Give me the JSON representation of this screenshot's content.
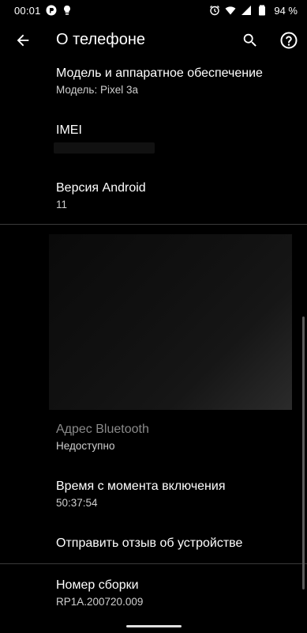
{
  "status_bar": {
    "time": "00:01",
    "battery": "94 %",
    "left_icons": [
      "app-notification-icon",
      "lightbulb-icon"
    ],
    "right_icons": [
      "alarm-icon",
      "wifi-icon",
      "signal-icon",
      "battery-icon"
    ]
  },
  "app_bar": {
    "title": "О телефоне",
    "icons": [
      "back-arrow-icon",
      "search-icon",
      "help-icon"
    ]
  },
  "items": {
    "model": {
      "title": "Модель и аппаратное обеспечение",
      "summary": "Модель: Pixel 3a"
    },
    "imei": {
      "title": "IMEI"
    },
    "android_version": {
      "title": "Версия Android",
      "summary": "11"
    },
    "bluetooth": {
      "title": "Адрес Bluetooth",
      "summary": "Недоступно"
    },
    "uptime": {
      "title": "Время с момента включения",
      "summary": "50:37:54"
    },
    "feedback": {
      "title": "Отправить отзыв об устройстве"
    },
    "build": {
      "title": "Номер сборки",
      "summary": "RP1A.200720.009"
    }
  },
  "colors": {
    "background": "#000000",
    "text_primary": "#ffffff",
    "text_disabled": "#8a8a8a",
    "divider": "#3a3a3a"
  }
}
